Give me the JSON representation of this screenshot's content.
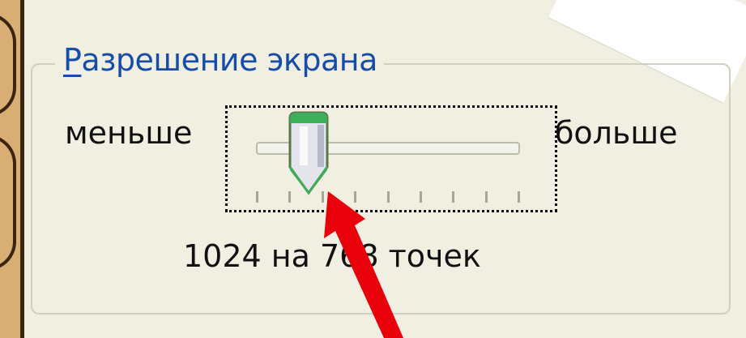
{
  "group": {
    "title_mnemonic": "Р",
    "title_rest": "азрешение экрана"
  },
  "slider": {
    "min_label": "меньше",
    "max_label": "больше",
    "position_fraction": 0.2,
    "tick_count": 9
  },
  "resolution_text": "1024 на 768 точек",
  "colors": {
    "title": "#174da8",
    "thumb_cap": "#3fae5a",
    "arrow": "#e8000b"
  }
}
